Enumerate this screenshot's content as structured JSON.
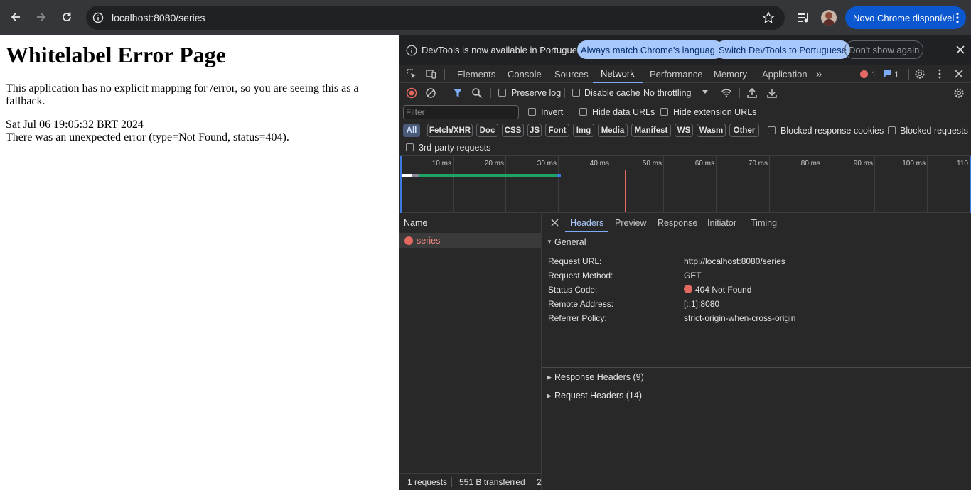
{
  "browser": {
    "url": "localhost:8080/series",
    "update_label": "Novo Chrome disponível"
  },
  "page": {
    "title": "Whitelabel Error Page",
    "paragraph": "This application has no explicit mapping for /error, so you are seeing this as a fallback.",
    "timestamp": "Sat Jul 06 19:05:32 BRT 2024",
    "error": "There was an unexpected error (type=Not Found, status=404)."
  },
  "devtools": {
    "banner": {
      "text": "DevTools is now available in Portuguese!",
      "match_language": "Always match Chrome's language",
      "switch": "Switch DevTools to Portuguese",
      "dont_show": "Don't show again"
    },
    "tabs": [
      "Elements",
      "Console",
      "Sources",
      "Network",
      "Performance",
      "Memory",
      "Application"
    ],
    "errors_count": "1",
    "messages_count": "1",
    "toolbar": {
      "preserve_log": "Preserve log",
      "disable_cache": "Disable cache",
      "throttling": "No throttling"
    },
    "filter": {
      "placeholder": "Filter",
      "invert": "Invert",
      "hide_data_urls": "Hide data URLs",
      "hide_extension_urls": "Hide extension URLs"
    },
    "types": [
      "All",
      "Fetch/XHR",
      "Doc",
      "CSS",
      "JS",
      "Font",
      "Img",
      "Media",
      "Manifest",
      "WS",
      "Wasm",
      "Other"
    ],
    "blocked_response_cookies": "Blocked response cookies",
    "blocked_requests": "Blocked requests",
    "third_party": "3rd-party requests",
    "timeline_ticks": [
      "10 ms",
      "20 ms",
      "30 ms",
      "40 ms",
      "50 ms",
      "60 ms",
      "70 ms",
      "80 ms",
      "90 ms",
      "100 ms",
      "110"
    ],
    "requests": {
      "header": "Name",
      "items": [
        "series"
      ],
      "footer_count": "1 requests",
      "footer_transferred": "551 B transferred",
      "footer_cut": "2"
    },
    "detail_tabs": [
      "Headers",
      "Preview",
      "Response",
      "Initiator",
      "Timing"
    ],
    "general": {
      "title": "General",
      "rows": [
        {
          "key": "Request URL:",
          "value": "http://localhost:8080/series"
        },
        {
          "key": "Request Method:",
          "value": "GET"
        },
        {
          "key": "Status Code:",
          "value": "404 Not Found"
        },
        {
          "key": "Remote Address:",
          "value": "[::1]:8080"
        },
        {
          "key": "Referrer Policy:",
          "value": "strict-origin-when-cross-origin"
        }
      ]
    },
    "response_headers": "Response Headers (9)",
    "request_headers": "Request Headers (14)",
    "colors": {
      "accent": "#7cacf8",
      "error": "#e46962",
      "update_pill": "#0b57d0"
    }
  }
}
